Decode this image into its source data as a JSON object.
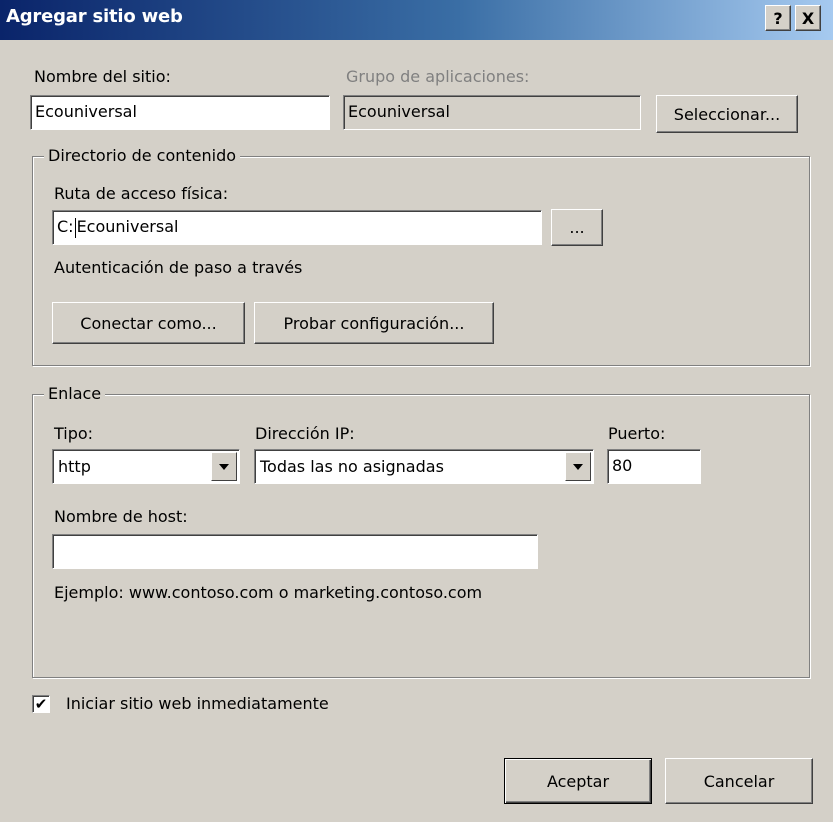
{
  "window": {
    "title": "Agregar sitio web",
    "help_label": "?",
    "close_label": "X"
  },
  "site": {
    "name_label": "Nombre del sitio:",
    "name_value": "Ecouniversal",
    "app_pool_label": "Grupo de aplicaciones:",
    "app_pool_value": "Ecouniversal",
    "select_button": "Seleccionar..."
  },
  "content_dir": {
    "legend": "Directorio de contenido",
    "path_label": "Ruta de acceso física:",
    "path_prefix": "C:",
    "path_rest": "Ecouniversal",
    "browse_button": "...",
    "passthrough_label": "Autenticación de paso a través",
    "connect_as_button": "Conectar como...",
    "test_settings_button": "Probar configuración..."
  },
  "binding": {
    "legend": "Enlace",
    "type_label": "Tipo:",
    "type_value": "http",
    "ip_label": "Dirección IP:",
    "ip_value": "Todas las no asignadas",
    "port_label": "Puerto:",
    "port_value": "80",
    "host_label": "Nombre de host:",
    "host_value": "",
    "example_text": "Ejemplo: www.contoso.com o marketing.contoso.com"
  },
  "start_immediately": {
    "label": "Iniciar sitio web inmediatamente",
    "checked": true,
    "check_glyph": "✔"
  },
  "footer": {
    "ok_button": "Aceptar",
    "cancel_button": "Cancelar"
  }
}
